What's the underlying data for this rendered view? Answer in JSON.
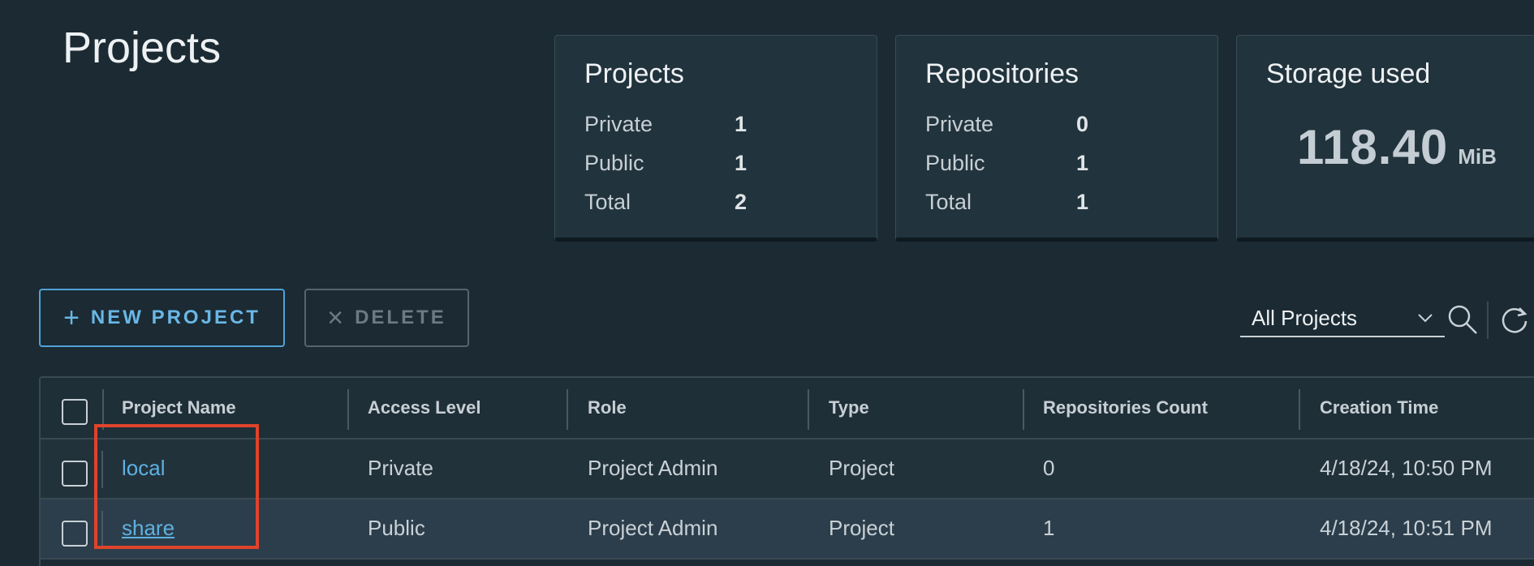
{
  "page": {
    "title": "Projects"
  },
  "summary": {
    "projects": {
      "title": "Projects",
      "rows": [
        {
          "label": "Private",
          "value": "1"
        },
        {
          "label": "Public",
          "value": "1"
        },
        {
          "label": "Total",
          "value": "2"
        }
      ]
    },
    "repositories": {
      "title": "Repositories",
      "rows": [
        {
          "label": "Private",
          "value": "0"
        },
        {
          "label": "Public",
          "value": "1"
        },
        {
          "label": "Total",
          "value": "1"
        }
      ]
    },
    "storage": {
      "title": "Storage used",
      "value": "118.40",
      "unit": "MiB"
    }
  },
  "toolbar": {
    "new_project_label": "NEW PROJECT",
    "delete_label": "DELETE",
    "filter_selected": "All Projects"
  },
  "table": {
    "columns": [
      "Project Name",
      "Access Level",
      "Role",
      "Type",
      "Repositories Count",
      "Creation Time"
    ],
    "rows": [
      {
        "name": "local",
        "access": "Private",
        "role": "Project Admin",
        "type": "Project",
        "repo_count": "0",
        "created": "4/18/24, 10:50 PM"
      },
      {
        "name": "share",
        "access": "Public",
        "role": "Project Admin",
        "type": "Project",
        "repo_count": "1",
        "created": "4/18/24, 10:51 PM"
      }
    ]
  },
  "colors": {
    "background": "#1b2a33",
    "accent": "#5fb0e1",
    "highlight": "#e0432b"
  },
  "icons": [
    "plus-icon",
    "close-icon",
    "chevron-down-icon",
    "search-icon",
    "refresh-icon"
  ]
}
